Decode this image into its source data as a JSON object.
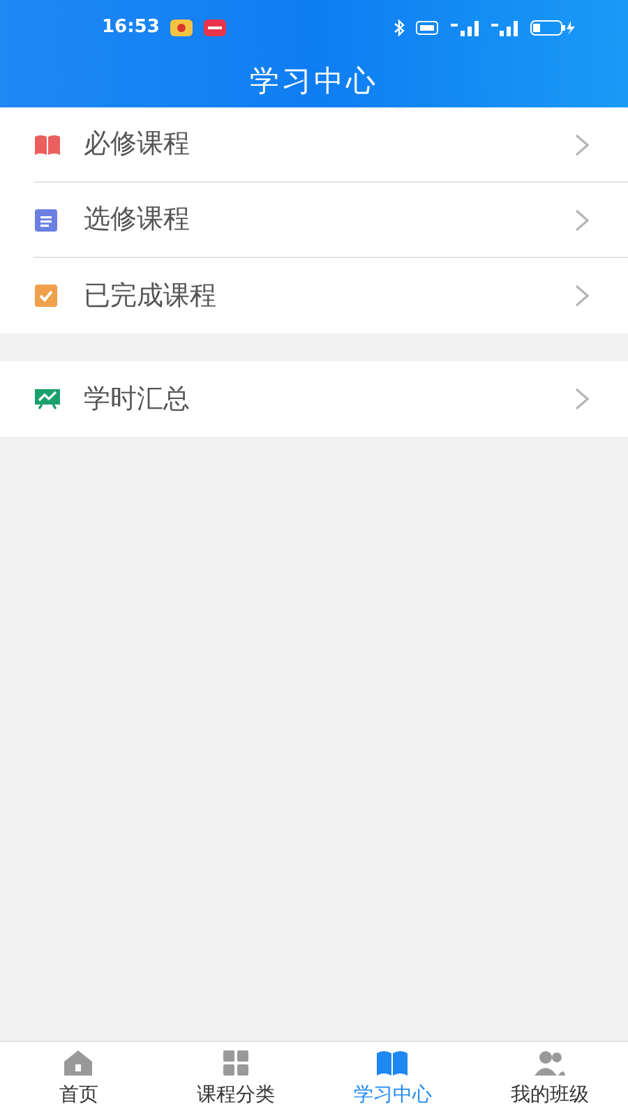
{
  "status_bar": {
    "time": "16:53"
  },
  "title": "学习中心",
  "sections": [
    {
      "items": [
        {
          "label": "必修课程",
          "kind": "book"
        },
        {
          "label": "选修课程",
          "kind": "doc"
        },
        {
          "label": "已完成课程",
          "kind": "check"
        }
      ]
    },
    {
      "items": [
        {
          "label": "学时汇总",
          "kind": "chart"
        }
      ]
    }
  ],
  "tabs": [
    {
      "label": "首页",
      "kind": "home",
      "selected": false
    },
    {
      "label": "课程分类",
      "kind": "grid",
      "selected": false
    },
    {
      "label": "学习中心",
      "kind": "study",
      "selected": true
    },
    {
      "label": "我的班级",
      "kind": "class",
      "selected": false
    }
  ]
}
